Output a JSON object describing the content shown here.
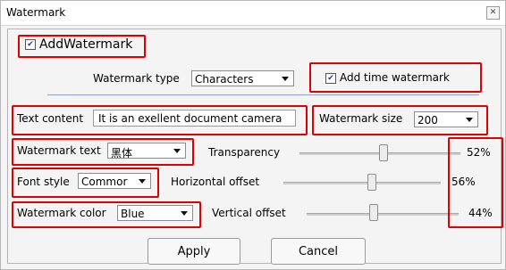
{
  "window": {
    "title": "Watermark",
    "close_icon": "close-icon"
  },
  "add_watermark": {
    "label": "AddWatermark",
    "checked": true
  },
  "watermark_type": {
    "label": "Watermark type",
    "value": "Characters"
  },
  "time_watermark": {
    "label": "Add time watermark",
    "checked": true
  },
  "text_content": {
    "label": "Text content",
    "value": "It is an exellent document camera"
  },
  "watermark_size": {
    "label": "Watermark size",
    "value": "200"
  },
  "watermark_text": {
    "label": "Watermark text",
    "value": "黑体"
  },
  "font_style": {
    "label": "Font style",
    "value": "Commor"
  },
  "watermark_color": {
    "label": "Watermark color",
    "value": "Blue"
  },
  "sliders": {
    "transparency": {
      "label": "Transparency",
      "value_text": "52%",
      "value": 52
    },
    "horizontal_offset": {
      "label": "Horizontal offset",
      "value_text": "56%",
      "value": 56
    },
    "vertical_offset": {
      "label": "Vertical offset",
      "value_text": "44%",
      "value": 44
    }
  },
  "buttons": {
    "apply": "Apply",
    "cancel": "Cancel"
  },
  "colors": {
    "highlight": "#e10000",
    "window_bg": "#f4f4f4"
  }
}
